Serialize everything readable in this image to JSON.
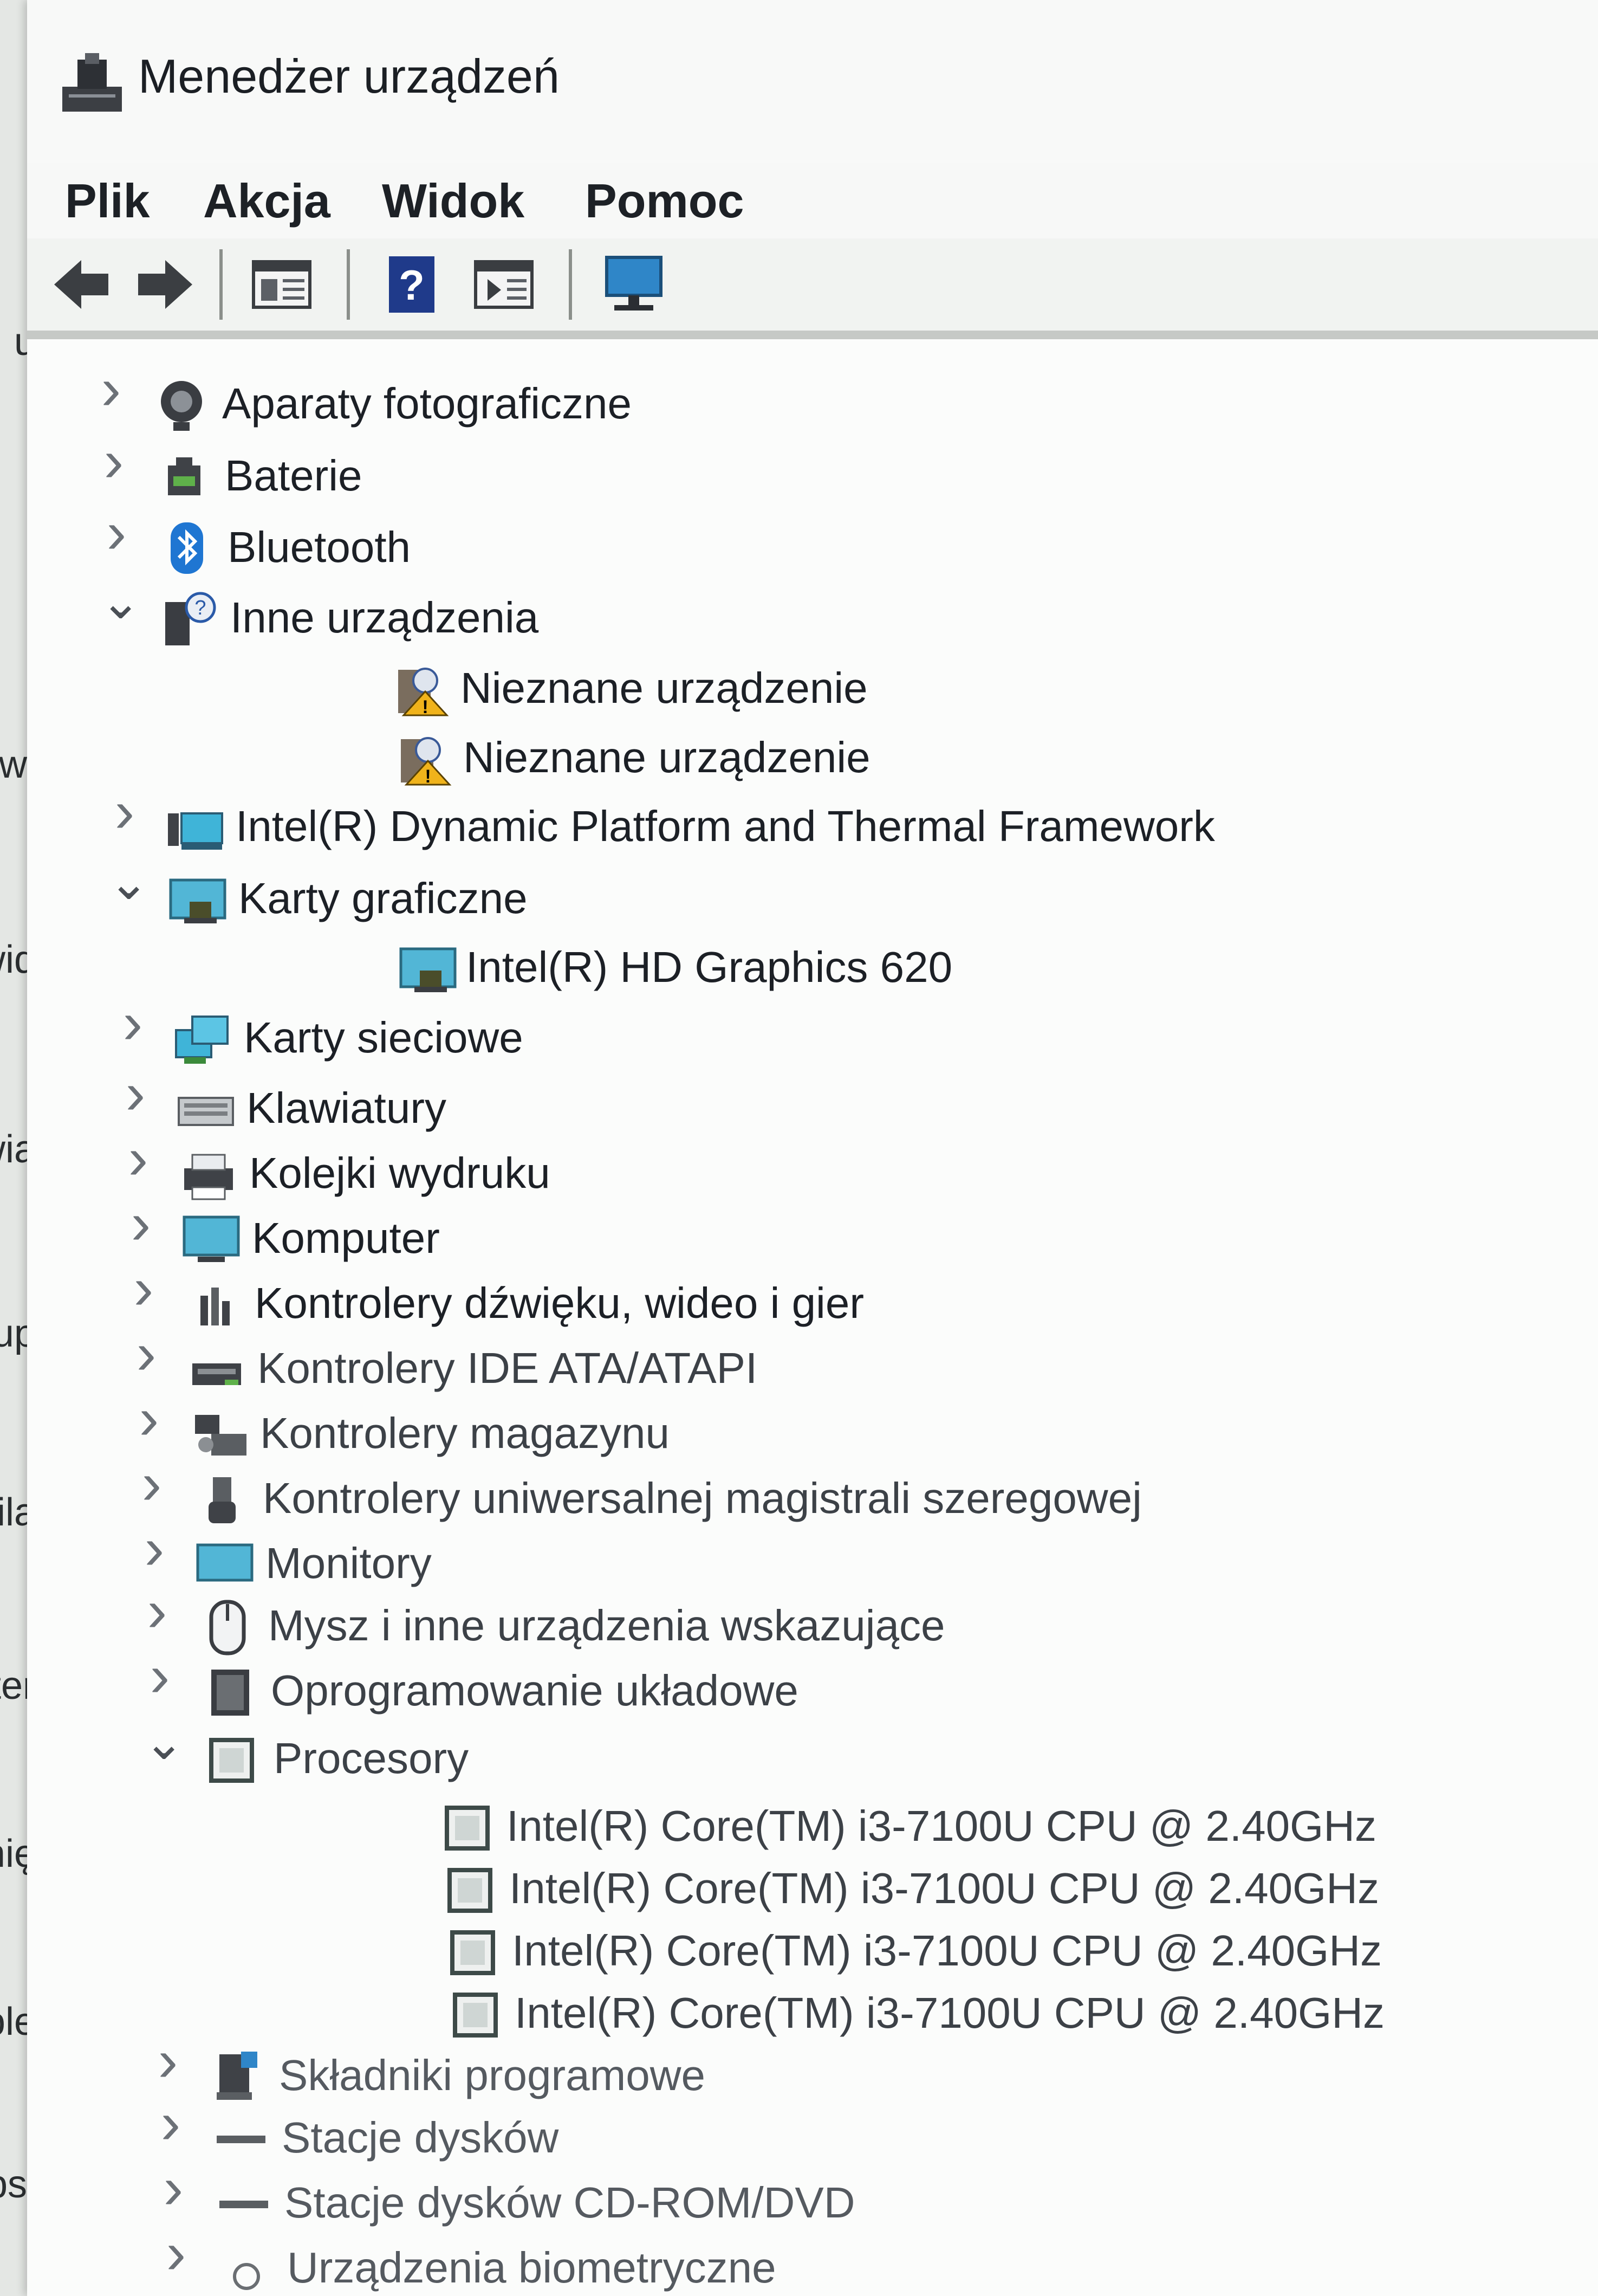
{
  "window": {
    "title": "Menedżer urządzeń"
  },
  "menu": [
    "Plik",
    "Akcja",
    "Widok",
    "Pomoc"
  ],
  "toolbar": {
    "buttons": [
      "back-arrow-icon",
      "forward-arrow-icon",
      "show-hide-console-tree-icon",
      "help-icon",
      "properties-panel-icon",
      "monitor-icon"
    ]
  },
  "background_window": {
    "labels": [
      "u",
      "świ",
      "wid",
      "owia",
      "kup",
      "Zasila",
      "Bater",
      "Pamię",
      "Table",
      "Obsł"
    ]
  },
  "tree": [
    {
      "label": "Aparaty fotograficzne",
      "state": "collapsed",
      "level": 0,
      "icon": "camera-icon"
    },
    {
      "label": "Baterie",
      "state": "collapsed",
      "level": 0,
      "icon": "battery-icon"
    },
    {
      "label": "Bluetooth",
      "state": "collapsed",
      "level": 0,
      "icon": "bluetooth-icon"
    },
    {
      "label": "Inne urządzenia",
      "state": "expanded",
      "level": 0,
      "icon": "unknown-device-icon"
    },
    {
      "label": "Nieznane urządzenie",
      "state": "leaf",
      "level": 1,
      "icon": "warning-device-icon"
    },
    {
      "label": "Nieznane urządzenie",
      "state": "leaf",
      "level": 1,
      "icon": "warning-device-icon"
    },
    {
      "label": "Intel(R) Dynamic Platform and Thermal Framework",
      "state": "collapsed",
      "level": 0,
      "icon": "system-device-icon"
    },
    {
      "label": "Karty graficzne",
      "state": "expanded",
      "level": 0,
      "icon": "display-adapter-icon"
    },
    {
      "label": "Intel(R) HD Graphics 620",
      "state": "leaf",
      "level": 1,
      "icon": "display-adapter-icon"
    },
    {
      "label": "Karty sieciowe",
      "state": "collapsed",
      "level": 0,
      "icon": "network-adapter-icon"
    },
    {
      "label": "Klawiatury",
      "state": "collapsed",
      "level": 0,
      "icon": "keyboard-icon"
    },
    {
      "label": "Kolejki wydruku",
      "state": "collapsed",
      "level": 0,
      "icon": "printer-icon"
    },
    {
      "label": "Komputer",
      "state": "collapsed",
      "level": 0,
      "icon": "computer-icon"
    },
    {
      "label": "Kontrolery dźwięku, wideo i gier",
      "state": "collapsed",
      "level": 0,
      "icon": "sound-icon"
    },
    {
      "label": "Kontrolery IDE ATA/ATAPI",
      "state": "collapsed",
      "level": 0,
      "icon": "ide-controller-icon"
    },
    {
      "label": "Kontrolery magazynu",
      "state": "collapsed",
      "level": 0,
      "icon": "storage-controller-icon"
    },
    {
      "label": "Kontrolery uniwersalnej magistrali szeregowej",
      "state": "collapsed",
      "level": 0,
      "icon": "usb-icon"
    },
    {
      "label": "Monitory",
      "state": "collapsed",
      "level": 0,
      "icon": "monitor-icon"
    },
    {
      "label": "Mysz i inne urządzenia wskazujące",
      "state": "collapsed",
      "level": 0,
      "icon": "mouse-icon"
    },
    {
      "label": "Oprogramowanie układowe",
      "state": "collapsed",
      "level": 0,
      "icon": "firmware-icon"
    },
    {
      "label": "Procesory",
      "state": "expanded",
      "level": 0,
      "icon": "processor-icon"
    },
    {
      "label": "Intel(R) Core(TM) i3-7100U CPU @ 2.40GHz",
      "state": "leaf",
      "level": 1,
      "icon": "processor-icon"
    },
    {
      "label": "Intel(R) Core(TM) i3-7100U CPU @ 2.40GHz",
      "state": "leaf",
      "level": 1,
      "icon": "processor-icon"
    },
    {
      "label": "Intel(R) Core(TM) i3-7100U CPU @ 2.40GHz",
      "state": "leaf",
      "level": 1,
      "icon": "processor-icon"
    },
    {
      "label": "Intel(R) Core(TM) i3-7100U CPU @ 2.40GHz",
      "state": "leaf",
      "level": 1,
      "icon": "processor-icon"
    },
    {
      "label": "Składniki programowe",
      "state": "collapsed",
      "level": 0,
      "icon": "software-component-icon"
    },
    {
      "label": "Stacje dysków",
      "state": "collapsed",
      "level": 0,
      "icon": "disk-drive-icon"
    },
    {
      "label": "Stacje dysków CD-ROM/DVD",
      "state": "collapsed",
      "level": 0,
      "icon": "dvd-drive-icon"
    },
    {
      "label": "Urządzenia biometryczne",
      "state": "collapsed",
      "level": 0,
      "icon": "biometric-icon"
    }
  ]
}
